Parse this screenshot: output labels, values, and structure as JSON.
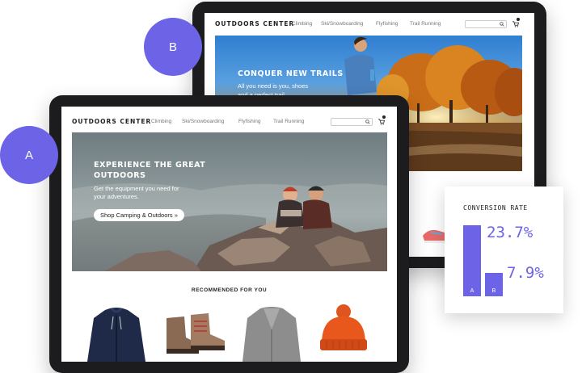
{
  "variant_a": {
    "label": "A",
    "logo": "OUTDOORS CENTER",
    "nav": [
      "Climbing",
      "Ski/Snowboarding",
      "Flyfishing",
      "Trail Running"
    ],
    "hero_title_line1": "EXPERIENCE THE GREAT",
    "hero_title_line2": "OUTDOORS",
    "hero_sub_line1": "Get the equipment you need for",
    "hero_sub_line2": "your adventures.",
    "cta": "Shop Camping & Outdoors »",
    "recommended": "RECOMMENDED FOR YOU",
    "products": [
      "navy jacket",
      "hiking boots",
      "grey cardigan",
      "orange beanie"
    ]
  },
  "variant_b": {
    "label": "B",
    "logo": "OUTDOORS CENTER",
    "nav": [
      "Climbing",
      "Ski/Snowboarding",
      "Flyfishing",
      "Trail Running"
    ],
    "hero_title": "CONQUER NEW TRAILS",
    "hero_sub_line1": "All you need is you, shoes",
    "hero_sub_line2": "and a perfect trail."
  },
  "conversion": {
    "title": "CONVERSION RATE",
    "a_label": "A",
    "b_label": "B",
    "a_value": "23.7%",
    "b_value": "7.9%",
    "a_rate": 23.7,
    "b_rate": 7.9,
    "bar_color": "#6c63e6"
  },
  "colors": {
    "accent": "#6c63e6",
    "bezel": "#1c1c1f"
  }
}
